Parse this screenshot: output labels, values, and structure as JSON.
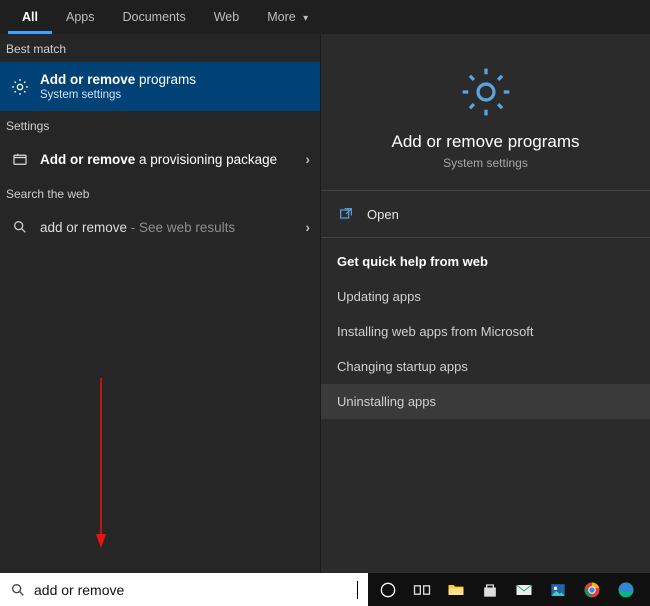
{
  "tabs": {
    "all": "All",
    "apps": "Apps",
    "documents": "Documents",
    "web": "Web",
    "more": "More"
  },
  "left": {
    "best_match_label": "Best match",
    "best": {
      "bold": "Add or remove",
      "rest": " programs",
      "sub": "System settings"
    },
    "settings_label": "Settings",
    "settings_item": {
      "bold": "Add or remove",
      "rest": " a provisioning package"
    },
    "web_label": "Search the web",
    "web_item": {
      "query": "add or remove",
      "suffix": " - See web results"
    }
  },
  "right": {
    "title": "Add or remove programs",
    "sub": "System settings",
    "open": "Open",
    "help_header": "Get quick help from web",
    "help": {
      "updating": "Updating apps",
      "installing": "Installing web apps from Microsoft",
      "startup": "Changing startup apps",
      "uninstalling": "Uninstalling apps"
    }
  },
  "search": {
    "value": "add or remove"
  }
}
